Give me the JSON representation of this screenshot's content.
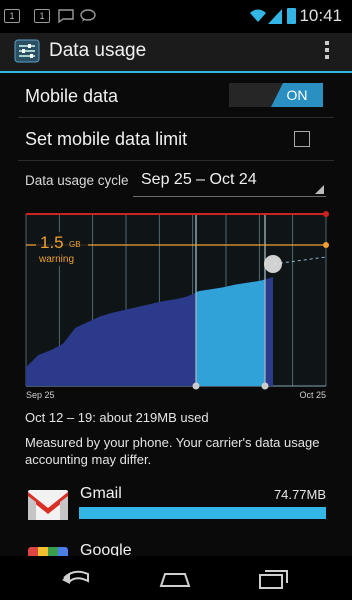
{
  "status_bar": {
    "time": "10:41",
    "notification_icons": [
      "sim-notification-icon",
      "sim-notification-icon",
      "chat-icon",
      "chat-bubble-icon"
    ],
    "status_icons": [
      "wifi-icon",
      "signal-icon",
      "battery-icon"
    ]
  },
  "action_bar": {
    "title": "Data usage",
    "icon": "data-usage-settings-icon",
    "overflow_icon": "overflow-menu-icon"
  },
  "mobile_data": {
    "label": "Mobile data",
    "toggle_state": "ON"
  },
  "data_limit": {
    "label": "Set mobile data limit",
    "checked": false
  },
  "cycle": {
    "label": "Data usage cycle",
    "value": "Sep 25 – Oct 24"
  },
  "chart": {
    "warning_value": "1.5",
    "warning_unit": "GB",
    "warning_label": "warning",
    "start_label": "Sep 25",
    "end_label": "Oct 25",
    "colors": {
      "limit_line": "#cc2222",
      "warning_line": "#f0a030",
      "usage_fill": "#2c3a8c",
      "selected_fill": "#33b5e5",
      "gridline": "#7fa8b8"
    }
  },
  "chart_data": {
    "type": "area",
    "title": "",
    "xlabel": "",
    "ylabel": "",
    "x_range": [
      "Sep 25",
      "Oct 25"
    ],
    "warning_level_gb": 1.5,
    "selected_range": [
      "Oct 12",
      "Oct 19"
    ],
    "cumulative_usage_gb": [
      0.2,
      0.33,
      0.38,
      0.45,
      0.62,
      0.68,
      0.74,
      0.78,
      0.81,
      0.84,
      0.87,
      0.9,
      0.92,
      0.95,
      1.01,
      1.03,
      1.05,
      1.08,
      1.1,
      1.12,
      1.16
    ]
  },
  "usage_summary": "Oct 12 – 19: about 219MB used",
  "disclaimer": "Measured by your phone. Your carrier's data usage accounting may differ.",
  "apps": [
    {
      "name": "Gmail",
      "size": "74.77MB",
      "fraction": 1.0,
      "icon": "gmail-icon"
    }
  ],
  "next_app": {
    "name": "Google",
    "icon": "google-app-icon"
  },
  "nav_bar": {
    "back_icon": "back-icon",
    "home_icon": "home-icon",
    "recents_icon": "recent-apps-icon"
  }
}
